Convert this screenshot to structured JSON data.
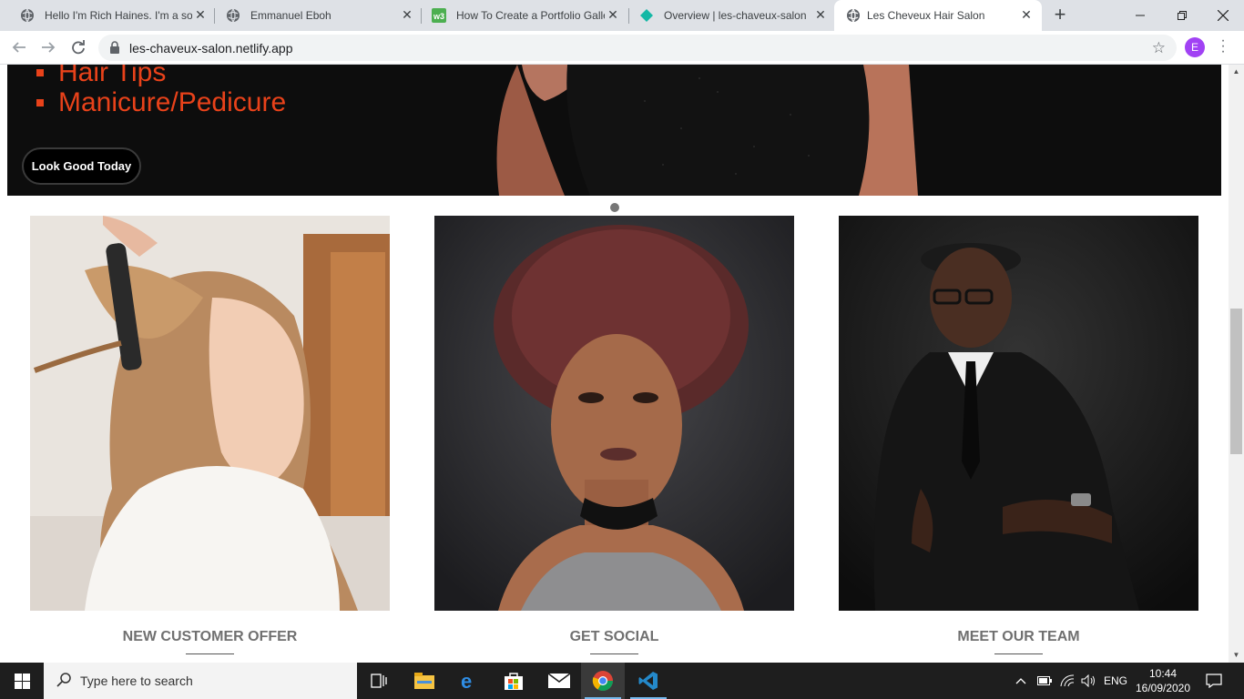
{
  "browser": {
    "tabs": [
      {
        "title": "Hello I'm Rich Haines. I'm a sof",
        "icon": "globe-icon"
      },
      {
        "title": "Emmanuel Eboh",
        "icon": "globe-icon"
      },
      {
        "title": "How To Create a Portfolio Galle",
        "icon": "w3-icon"
      },
      {
        "title": "Overview | les-chaveux-salon",
        "icon": "netlify-icon"
      },
      {
        "title": "Les Cheveux Hair Salon",
        "icon": "globe-icon",
        "active": true
      }
    ],
    "url": "les-chaveux-salon.netlify.app",
    "profile_initial": "E"
  },
  "hero": {
    "list": [
      "Hair Tips",
      "Manicure/Pedicure"
    ],
    "cta": "Look Good Today",
    "accent": "#e8421a"
  },
  "cards": [
    {
      "caption": "NEW CUSTOMER OFFER"
    },
    {
      "caption": "GET SOCIAL"
    },
    {
      "caption": "MEET OUR TEAM"
    }
  ],
  "taskbar": {
    "search_placeholder": "Type here to search",
    "lang": "ENG",
    "time": "10:44",
    "date": "16/09/2020"
  }
}
